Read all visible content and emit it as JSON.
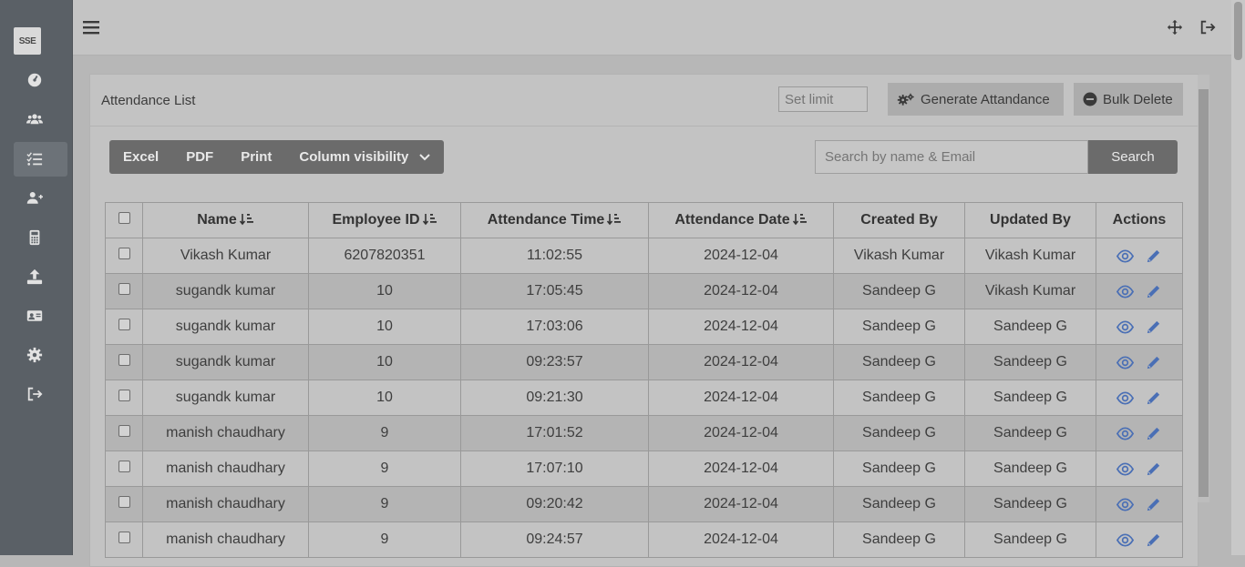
{
  "logo": {
    "text": "SSE"
  },
  "sidebar": {
    "items": [
      {
        "icon": "dashboard-icon"
      },
      {
        "icon": "users-icon"
      },
      {
        "icon": "list-check-icon",
        "active": true
      },
      {
        "icon": "user-plus-icon"
      },
      {
        "icon": "calculator-icon"
      },
      {
        "icon": "upload-icon"
      },
      {
        "icon": "id-card-icon"
      },
      {
        "icon": "gear-icon"
      },
      {
        "icon": "logout-icon"
      }
    ]
  },
  "card": {
    "title": "Attendance List",
    "limit_placeholder": "Set limit",
    "generate_label": "Generate Attandance",
    "bulk_delete_label": "Bulk Delete"
  },
  "toolbar": {
    "excel": "Excel",
    "pdf": "PDF",
    "print": "Print",
    "column_visibility": "Column visibility",
    "search_placeholder": "Search by name & Email",
    "search_button": "Search"
  },
  "table": {
    "headers": {
      "name": "Name",
      "employee_id": "Employee ID",
      "attendance_time": "Attendance Time",
      "attendance_date": "Attendance Date",
      "created_by": "Created By",
      "updated_by": "Updated By",
      "actions": "Actions"
    },
    "rows": [
      {
        "name": "Vikash Kumar",
        "employee_id": "6207820351",
        "time": "11:02:55",
        "date": "2024-12-04",
        "created_by": "Vikash Kumar",
        "updated_by": "Vikash Kumar"
      },
      {
        "name": "sugandk kumar",
        "employee_id": "10",
        "time": "17:05:45",
        "date": "2024-12-04",
        "created_by": "Sandeep G",
        "updated_by": "Vikash Kumar"
      },
      {
        "name": "sugandk kumar",
        "employee_id": "10",
        "time": "17:03:06",
        "date": "2024-12-04",
        "created_by": "Sandeep G",
        "updated_by": "Sandeep G"
      },
      {
        "name": "sugandk kumar",
        "employee_id": "10",
        "time": "09:23:57",
        "date": "2024-12-04",
        "created_by": "Sandeep G",
        "updated_by": "Sandeep G"
      },
      {
        "name": "sugandk kumar",
        "employee_id": "10",
        "time": "09:21:30",
        "date": "2024-12-04",
        "created_by": "Sandeep G",
        "updated_by": "Sandeep G"
      },
      {
        "name": "manish chaudhary",
        "employee_id": "9",
        "time": "17:01:52",
        "date": "2024-12-04",
        "created_by": "Sandeep G",
        "updated_by": "Sandeep G"
      },
      {
        "name": "manish chaudhary",
        "employee_id": "9",
        "time": "17:07:10",
        "date": "2024-12-04",
        "created_by": "Sandeep G",
        "updated_by": "Sandeep G"
      },
      {
        "name": "manish chaudhary",
        "employee_id": "9",
        "time": "09:20:42",
        "date": "2024-12-04",
        "created_by": "Sandeep G",
        "updated_by": "Sandeep G"
      },
      {
        "name": "manish chaudhary",
        "employee_id": "9",
        "time": "09:24:57",
        "date": "2024-12-04",
        "created_by": "Sandeep G",
        "updated_by": "Sandeep G"
      }
    ]
  },
  "colors": {
    "action_icon": "#4a6fb5",
    "sidebar_bg": "#5a6066"
  }
}
